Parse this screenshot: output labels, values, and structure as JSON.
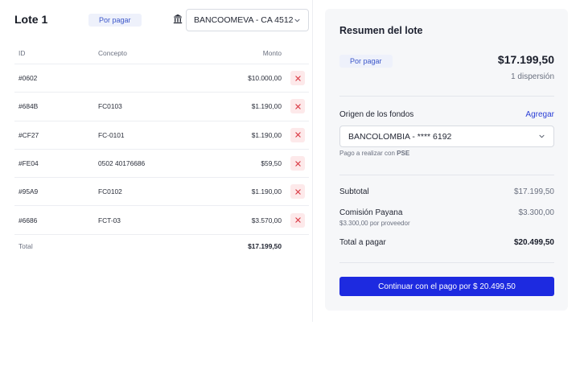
{
  "lote": {
    "title": "Lote 1",
    "status_badge": "Por pagar",
    "bank_account": "BANCOOMEVA - CA 4512",
    "table": {
      "headers": {
        "id": "ID",
        "concept": "Concepto",
        "amount": "Monto"
      },
      "rows": [
        {
          "id": "#0602",
          "concept": "",
          "amount": "$10.000,00"
        },
        {
          "id": "#684B",
          "concept": "FC0103",
          "amount": "$1.190,00"
        },
        {
          "id": "#CF27",
          "concept": "FC-0101",
          "amount": "$1.190,00"
        },
        {
          "id": "#FE04",
          "concept": "0502 40176686",
          "amount": "$59,50"
        },
        {
          "id": "#95A9",
          "concept": "FC0102",
          "amount": "$1.190,00"
        },
        {
          "id": "#6686",
          "concept": "FCT-03",
          "amount": "$3.570,00"
        }
      ],
      "total_label": "Total",
      "total_amount": "$17.199,50"
    }
  },
  "summary": {
    "title": "Resumen del lote",
    "status_badge": "Por pagar",
    "amount": "$17.199,50",
    "dispersions": "1 dispersión",
    "origin_label": "Origen de los fondos",
    "add_link": "Agregar",
    "origin_account": "BANCOLOMBIA - **** 6192",
    "pay_note_prefix": "Pago a realizar con ",
    "pay_note_method": "PSE",
    "subtotal_label": "Subtotal",
    "subtotal_value": "$17.199,50",
    "commission_label": "Comisión Payana",
    "commission_value": "$3.300,00",
    "commission_note": "$3.300,00 por proveedor",
    "total_label": "Total a pagar",
    "total_value": "$20.499,50",
    "pay_button": "Continuar con el pago por $ 20.499,50"
  },
  "colors": {
    "accent": "#1d2ae0",
    "badge_text": "#3a55c9",
    "badge_bg": "#eef1fb",
    "delete_bg": "#fde9ea",
    "delete_icon": "#d9343f",
    "panel_bg": "#f6f7f9"
  },
  "icons": {
    "bank": "bank-icon",
    "chevron": "chevron-down-icon",
    "delete": "close-icon"
  }
}
